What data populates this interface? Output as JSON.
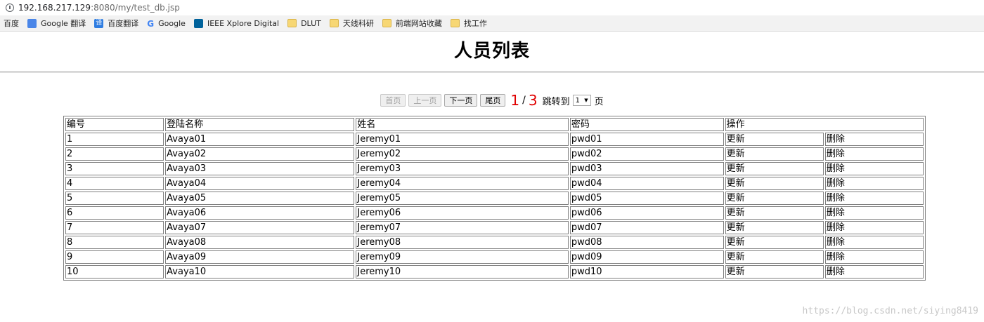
{
  "browser": {
    "url_host": "192.168.217.129",
    "url_rest": ":8080/my/test_db.jsp",
    "bookmarks": [
      {
        "label": "百度",
        "icon": "none"
      },
      {
        "label": "Google 翻译",
        "icon": "google-translate-icon"
      },
      {
        "label": "百度翻译",
        "icon": "baidu-translate-icon"
      },
      {
        "label": "Google",
        "icon": "google-icon"
      },
      {
        "label": "IEEE Xplore Digital",
        "icon": "ieee-icon"
      },
      {
        "label": "DLUT",
        "icon": "folder-icon"
      },
      {
        "label": "天线科研",
        "icon": "folder-icon"
      },
      {
        "label": "前端网站收藏",
        "icon": "folder-icon"
      },
      {
        "label": "找工作",
        "icon": "folder-icon"
      }
    ]
  },
  "page": {
    "title": "人员列表"
  },
  "pager": {
    "first_label": "首页",
    "prev_label": "上一页",
    "next_label": "下一页",
    "last_label": "尾页",
    "current_page": "1",
    "slash": "/",
    "total_pages": "3",
    "jump_label": "跳转到",
    "jump_value": "1",
    "page_suffix": "页"
  },
  "table": {
    "headers": [
      "编号",
      "登陆名称",
      "姓名",
      "密码",
      "操作"
    ],
    "rows": [
      {
        "id": "1",
        "login": "Avaya01",
        "name": "Jeremy01",
        "pwd": "pwd01",
        "update": "更新",
        "delete": "删除"
      },
      {
        "id": "2",
        "login": "Avaya02",
        "name": "Jeremy02",
        "pwd": "pwd02",
        "update": "更新",
        "delete": "删除"
      },
      {
        "id": "3",
        "login": "Avaya03",
        "name": "Jeremy03",
        "pwd": "pwd03",
        "update": "更新",
        "delete": "删除"
      },
      {
        "id": "4",
        "login": "Avaya04",
        "name": "Jeremy04",
        "pwd": "pwd04",
        "update": "更新",
        "delete": "删除"
      },
      {
        "id": "5",
        "login": "Avaya05",
        "name": "Jeremy05",
        "pwd": "pwd05",
        "update": "更新",
        "delete": "删除"
      },
      {
        "id": "6",
        "login": "Avaya06",
        "name": "Jeremy06",
        "pwd": "pwd06",
        "update": "更新",
        "delete": "删除"
      },
      {
        "id": "7",
        "login": "Avaya07",
        "name": "Jeremy07",
        "pwd": "pwd07",
        "update": "更新",
        "delete": "删除"
      },
      {
        "id": "8",
        "login": "Avaya08",
        "name": "Jeremy08",
        "pwd": "pwd08",
        "update": "更新",
        "delete": "删除"
      },
      {
        "id": "9",
        "login": "Avaya09",
        "name": "Jeremy09",
        "pwd": "pwd09",
        "update": "更新",
        "delete": "删除"
      },
      {
        "id": "10",
        "login": "Avaya10",
        "name": "Jeremy10",
        "pwd": "pwd10",
        "update": "更新",
        "delete": "删除"
      }
    ]
  },
  "watermark": "https://blog.csdn.net/siying8419"
}
